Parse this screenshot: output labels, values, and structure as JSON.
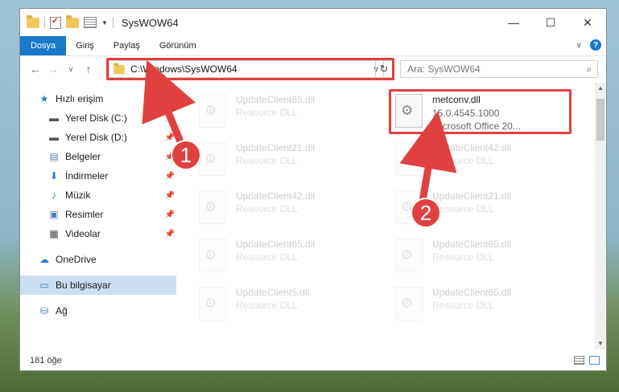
{
  "window": {
    "title": "SysWOW64",
    "controls": {
      "minimize": "—",
      "maximize": "☐",
      "close": "✕"
    }
  },
  "ribbon": {
    "tabs": [
      "Dosya",
      "Giriş",
      "Paylaş",
      "Görünüm"
    ],
    "active_tab": "Dosya"
  },
  "address_bar": {
    "path": "C:\\Windows\\SysWOW64",
    "search_placeholder": "Ara: SysWOW64"
  },
  "sidebar": {
    "items": [
      {
        "label": "Hızlı erişim",
        "icon": "star-icon"
      },
      {
        "label": "Yerel Disk (C:)",
        "icon": "drive-icon",
        "pinned": true
      },
      {
        "label": "Yerel Disk (D:)",
        "icon": "drive-icon",
        "pinned": true
      },
      {
        "label": "Belgeler",
        "icon": "documents-icon",
        "pinned": true
      },
      {
        "label": "İndirmeler",
        "icon": "download-icon",
        "pinned": true
      },
      {
        "label": "Müzik",
        "icon": "music-icon",
        "pinned": true
      },
      {
        "label": "Resimler",
        "icon": "pictures-icon",
        "pinned": true
      },
      {
        "label": "Videolar",
        "icon": "video-icon",
        "pinned": true
      },
      {
        "label": "OneDrive",
        "icon": "cloud-icon"
      },
      {
        "label": "Bu bilgisayar",
        "icon": "computer-icon",
        "selected": true
      },
      {
        "label": "Ağ",
        "icon": "network-icon"
      }
    ]
  },
  "files": {
    "highlighted": {
      "name": "metconv.dll",
      "version": "15.0.4545.1000",
      "description": "Microsoft Office 20..."
    },
    "left_column": [
      {
        "name": "UpdateClient65.dll",
        "type": "Resource DLL"
      },
      {
        "name": "UpdateClient21.dll",
        "type": "Resource DLL"
      },
      {
        "name": "UpdateClient42.dll",
        "type": "Resource DLL"
      },
      {
        "name": "UpdateClient65.dll",
        "type": "Resource DLL"
      },
      {
        "name": "UpdateClient5.dll",
        "type": "Resource DLL"
      }
    ],
    "right_column": [
      {
        "name": "UpdateClient42.dll",
        "type": "Resource DLL"
      },
      {
        "name": "UpdateClient21.dll",
        "type": "Resource DLL"
      },
      {
        "name": "UpdateClient65.dll",
        "type": "Resource DLL"
      },
      {
        "name": "UpdateClient65.dll",
        "type": "Resource DLL"
      }
    ]
  },
  "status": {
    "item_count": "181 öğe"
  },
  "callouts": {
    "one": "1",
    "two": "2"
  },
  "colors": {
    "accent": "#1979ca",
    "highlight": "#e0413f"
  }
}
